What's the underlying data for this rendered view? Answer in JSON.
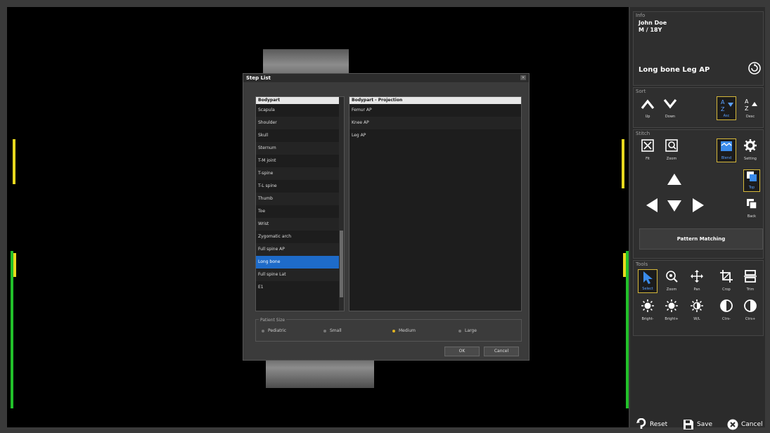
{
  "info": {
    "label": "Info",
    "patient_name": "John Doe",
    "patient_meta": "M / 18Y",
    "protocol": "Long bone Leg AP"
  },
  "sort": {
    "label": "Sort",
    "up": "Up",
    "down": "Down",
    "asc": "Asc",
    "desc": "Desc"
  },
  "stitch": {
    "label": "Stitch",
    "fit": "Fit",
    "zoom": "Zoom",
    "blend": "Blend",
    "setting": "Setting",
    "top": "Top",
    "back": "Back",
    "pattern_matching": "Pattern Matching"
  },
  "tools": {
    "label": "Tools",
    "select": "Select",
    "zoom": "Zoom",
    "pan": "Pan",
    "crop": "Crop",
    "trim": "Trim",
    "bright_minus": "Bright-",
    "bright_plus": "Bright+",
    "ww": "W/L",
    "ctrs_minus": "Ctrs-",
    "ctrs_plus": "Ctrs+"
  },
  "footer": {
    "reset": "Reset",
    "save": "Save",
    "cancel": "Cancel"
  },
  "dialog": {
    "title": "Step List",
    "bodypart_header": "Bodypart",
    "projection_header": "Bodypart - Projection",
    "bodyparts": [
      "Scapula",
      "Shoulder",
      "Skull",
      "Sternum",
      "T-M joint",
      "T-spine",
      "T-L spine",
      "Thumb",
      "Toe",
      "Wrist",
      "Zygomatic arch",
      "Full spine AP",
      "Long bone",
      "Full spine Lat",
      "E1"
    ],
    "selected_bodypart": "Long bone",
    "projections": [
      "Femur AP",
      "Knee AP",
      "Leg AP"
    ],
    "patient_size_label": "Patient Size",
    "sizes": [
      "Pediatric",
      "Small",
      "Medium",
      "Large"
    ],
    "selected_size": "Medium",
    "ok": "OK",
    "cancel": "Cancel"
  },
  "colors": {
    "accent_yellow": "#e8d81e",
    "accent_green": "#22c02a",
    "selection_blue": "#1e6bc9",
    "selected_border": "#d6b83a"
  }
}
